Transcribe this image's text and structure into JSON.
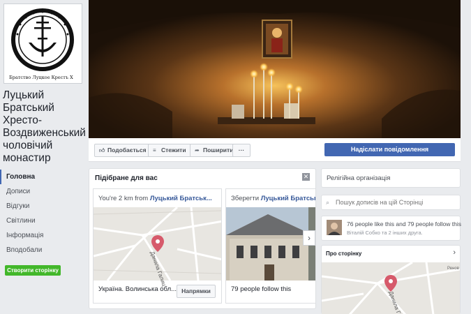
{
  "page": {
    "name": "Луцький Братський Хресто-Воздвиженський чоловічий монастир",
    "avatar_caption": "Братство Луцкое Крестъ X"
  },
  "nav": {
    "items": [
      "Головна",
      "Дописи",
      "Відгуки",
      "Світлини",
      "Інформація",
      "Вподобали"
    ],
    "create_page": "Створити сторінку"
  },
  "actions": {
    "like": "Подобається",
    "follow": "Стежити",
    "share": "Поширити",
    "more": "···",
    "send_message": "Надіслати повідомлення"
  },
  "suggest": {
    "title": "Підібране для вас",
    "card1": {
      "head_prefix": "You're 2 km from",
      "head_page": "Луцький Братськ...",
      "footer": "Україна. Волинська обл...",
      "button": "Напрямки",
      "map_street": "Данила Галиц"
    },
    "card2": {
      "head_prefix": "Зберегти",
      "head_page": "Луцький Братськ...",
      "footer": "79 people follow this"
    }
  },
  "right": {
    "category": "Релігійна організація",
    "search_placeholder": "Пошук дописів на цій Сторінці",
    "likes_line": "76 people like this and 79 people follow this",
    "friends_line": "Віталій Собко та 2 інших друга.",
    "about_title": "Про сторінку",
    "map_label": "Данила Г",
    "map_place": "Ренов"
  },
  "icons": {
    "close": "close-icon",
    "search": "search-icon",
    "next": "chevron-right-icon"
  },
  "colors": {
    "brand_blue": "#4267b2",
    "create_green": "#42b72a",
    "link_blue": "#365899",
    "pin_red": "#d65a6b"
  }
}
